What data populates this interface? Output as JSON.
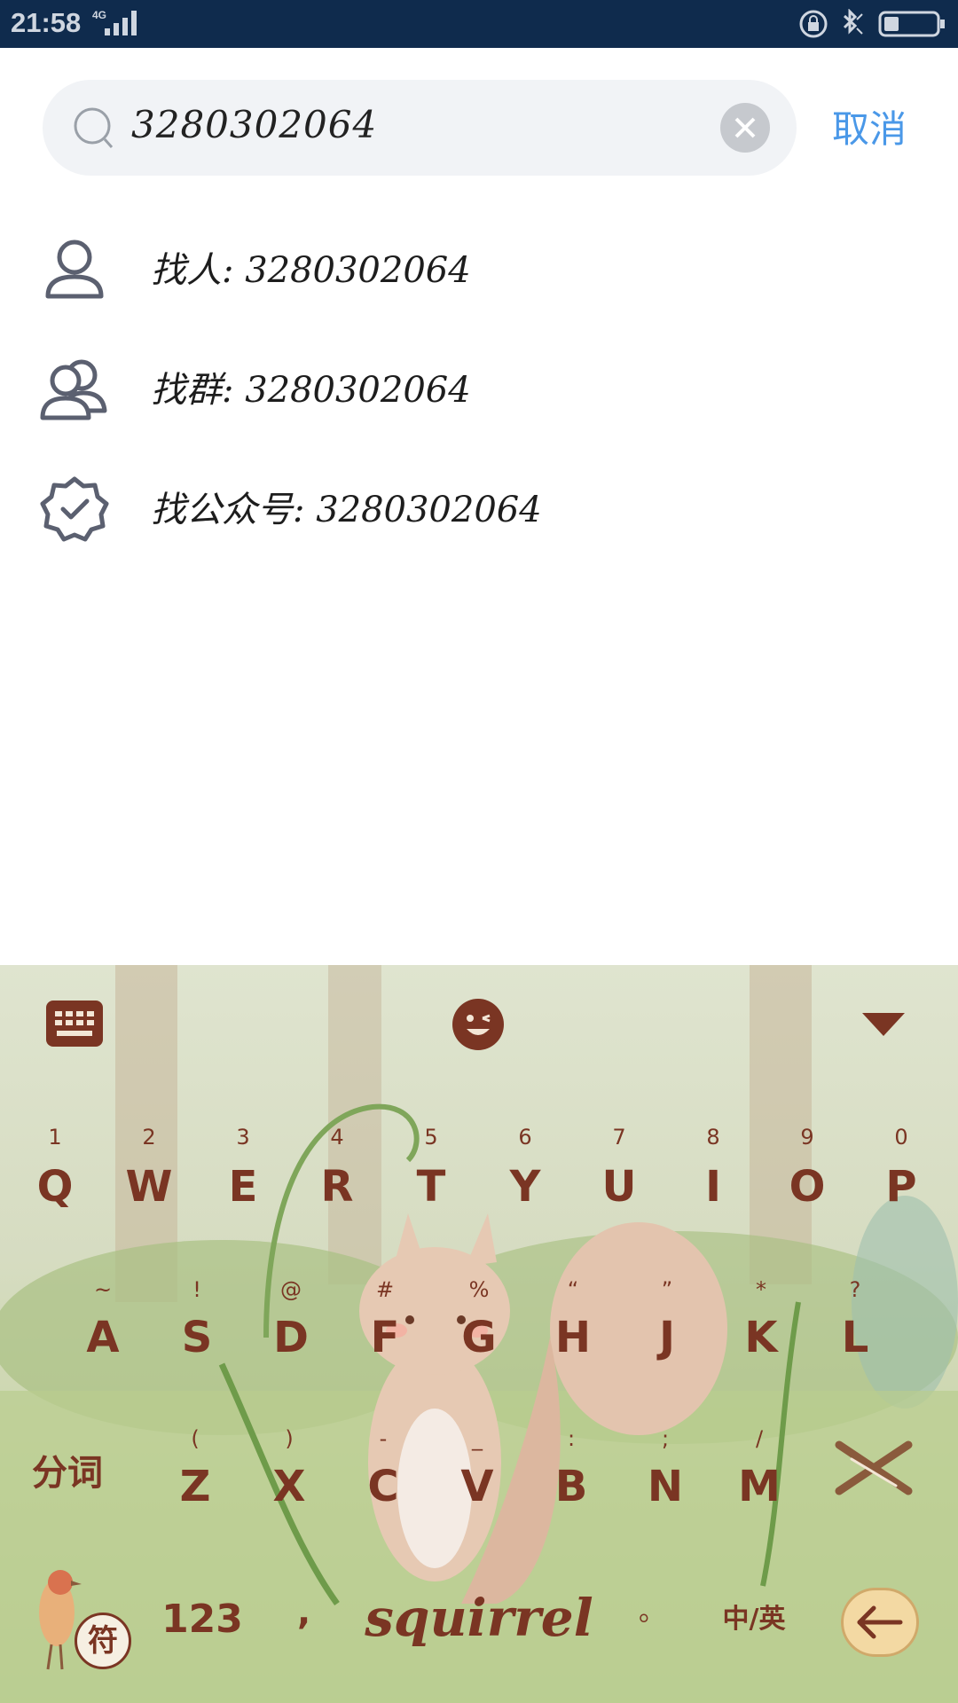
{
  "status_bar": {
    "time": "21:58",
    "network": "4G"
  },
  "search": {
    "query": "3280302064",
    "cancel_label": "取消"
  },
  "results": [
    {
      "label": "找人: 3280302064",
      "icon": "person-icon"
    },
    {
      "label": "找群: 3280302064",
      "icon": "group-icon"
    },
    {
      "label": "找公众号: 3280302064",
      "icon": "verified-badge-icon"
    }
  ],
  "keyboard": {
    "rows": [
      [
        {
          "main": "Q",
          "sub": "1"
        },
        {
          "main": "W",
          "sub": "2"
        },
        {
          "main": "E",
          "sub": "3"
        },
        {
          "main": "R",
          "sub": "4"
        },
        {
          "main": "T",
          "sub": "5"
        },
        {
          "main": "Y",
          "sub": "6"
        },
        {
          "main": "U",
          "sub": "7"
        },
        {
          "main": "I",
          "sub": "8"
        },
        {
          "main": "O",
          "sub": "9"
        },
        {
          "main": "P",
          "sub": "0"
        }
      ],
      [
        {
          "main": "A",
          "sub": "~"
        },
        {
          "main": "S",
          "sub": "!"
        },
        {
          "main": "D",
          "sub": "@"
        },
        {
          "main": "F",
          "sub": "#"
        },
        {
          "main": "G",
          "sub": "%"
        },
        {
          "main": "H",
          "sub": "“"
        },
        {
          "main": "J",
          "sub": "”"
        },
        {
          "main": "K",
          "sub": "*"
        },
        {
          "main": "L",
          "sub": "?"
        }
      ],
      [
        {
          "main": "Z",
          "sub": "("
        },
        {
          "main": "X",
          "sub": ")"
        },
        {
          "main": "C",
          "sub": "-"
        },
        {
          "main": "V",
          "sub": "_"
        },
        {
          "main": "B",
          "sub": ":"
        },
        {
          "main": "N",
          "sub": ";"
        },
        {
          "main": "M",
          "sub": "/"
        }
      ]
    ],
    "fenci_label": "分词",
    "symbol_label": "符",
    "numbers_label": "123",
    "comma_label": ",",
    "space_label": "squirrel",
    "period_label": "。",
    "lang_label": "中/英",
    "accent_color": "#7a3523"
  }
}
